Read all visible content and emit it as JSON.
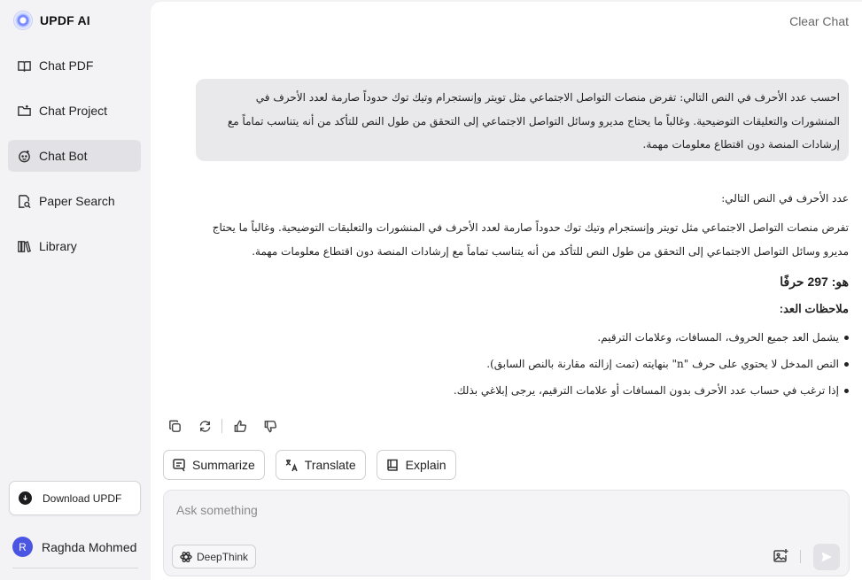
{
  "app": {
    "title": "UPDF AI"
  },
  "sidebar": {
    "items": [
      {
        "label": "Chat PDF",
        "icon": "book-open-icon"
      },
      {
        "label": "Chat Project",
        "icon": "folder-icon"
      },
      {
        "label": "Chat Bot",
        "icon": "bot-icon",
        "active": true
      },
      {
        "label": "Paper Search",
        "icon": "search-document-icon"
      },
      {
        "label": "Library",
        "icon": "library-icon"
      }
    ],
    "download_label": "Download UPDF",
    "user": {
      "initial": "R",
      "name": "Raghda Mohmed"
    }
  },
  "header": {
    "clear_label": "Clear Chat"
  },
  "conversation": {
    "user_message": "احسب عدد الأحرف في النص التالي: تفرض منصات التواصل الاجتماعي مثل تويتر وإنستجرام وتيك توك حدوداً صارمة لعدد الأحرف في المنشورات والتعليقات التوضيحية. وغالباً ما يحتاج مديرو وسائل التواصل الاجتماعي إلى التحقق من طول النص للتأكد من أنه يتناسب تماماً مع إرشادات المنصة دون اقتطاع معلومات مهمة.",
    "answer": {
      "intro": "عدد الأحرف في النص التالي:",
      "quoted": "تفرض منصات التواصل الاجتماعي مثل تويتر وإنستجرام وتيك توك حدوداً صارمة لعدد الأحرف في المنشورات والتعليقات التوضيحية. وغالباً ما يحتاج مديرو وسائل التواصل الاجتماعي إلى التحقق من طول النص للتأكد من أنه يتناسب تماماً مع إرشادات المنصة دون اقتطاع معلومات مهمة.",
      "count_line": "هو: 297 حرفًا",
      "notes_heading": "ملاحظات العد:",
      "notes": [
        "يشمل العد جميع الحروف، المسافات، وعلامات الترقيم.",
        "النص المدخل لا يحتوي على حرف \"n\" بنهايته (تمت إزالته مقارنة بالنص السابق).",
        "إذا ترغب في حساب عدد الأحرف بدون المسافات أو علامات الترقيم، يرجى إبلاغي بذلك."
      ]
    }
  },
  "quick_actions": [
    {
      "label": "Summarize",
      "icon": "summarize-icon"
    },
    {
      "label": "Translate",
      "icon": "translate-icon"
    },
    {
      "label": "Explain",
      "icon": "book-icon"
    }
  ],
  "composer": {
    "placeholder": "Ask something",
    "value": "",
    "deepthink_label": "DeepThink"
  }
}
